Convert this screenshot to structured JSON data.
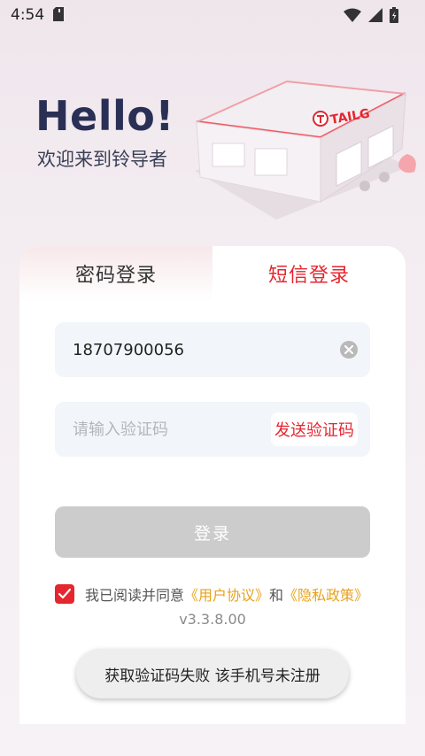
{
  "status_bar": {
    "time": "4:54",
    "left_icon": "sd-card-icon",
    "right_icons": [
      "wifi-icon",
      "signal-icon",
      "battery-icon"
    ]
  },
  "header": {
    "greeting": "Hello!",
    "welcome": "欢迎来到铃导者",
    "illustration_sign": "TAILG"
  },
  "tabs": [
    {
      "label": "密码登录",
      "active": false
    },
    {
      "label": "短信登录",
      "active": true
    }
  ],
  "phone_field": {
    "value": "18707900056",
    "clear_icon": "clear-icon"
  },
  "code_field": {
    "placeholder": "请输入验证码",
    "send_label": "发送验证码"
  },
  "login_button": {
    "label": "登录"
  },
  "agreement": {
    "checked": true,
    "prefix": "我已阅读并同意",
    "user_agreement": "《用户协议》",
    "and": "和",
    "privacy_policy": "《隐私政策》"
  },
  "version": "v3.3.8.00",
  "toast": "获取验证码失败 该手机号未注册",
  "colors": {
    "accent_red": "#e5262f",
    "link_orange": "#e7a21c",
    "title_navy": "#2a2f55",
    "disabled_button": "#cccccc"
  }
}
